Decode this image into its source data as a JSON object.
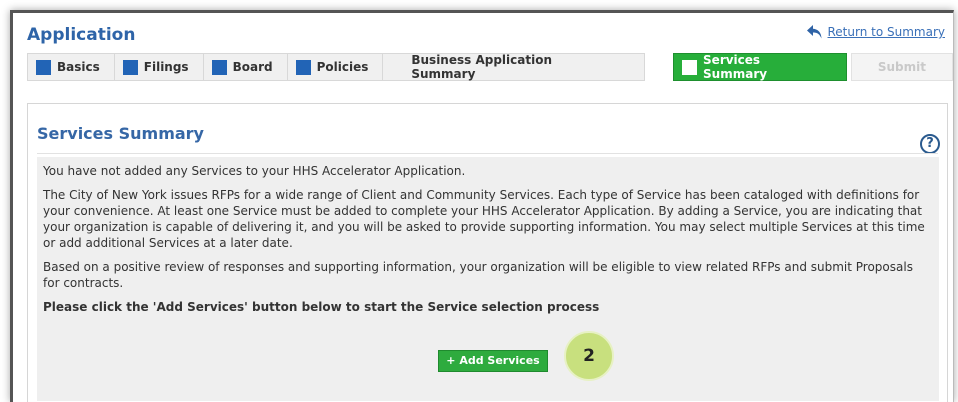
{
  "header": {
    "title": "Application",
    "return_label": "Return to Summary"
  },
  "tabs": [
    {
      "label": "Basics"
    },
    {
      "label": "Filings"
    },
    {
      "label": "Board"
    },
    {
      "label": "Policies"
    },
    {
      "label": "Business Application Summary"
    },
    {
      "label": "Services Summary"
    },
    {
      "label": "Submit"
    }
  ],
  "panel": {
    "title": "Services Summary",
    "help_glyph": "?",
    "paragraphs": [
      "You have not added any Services to your HHS Accelerator Application.",
      "The City of New York issues RFPs for a wide range of Client and Community Services. Each type of Service has been cataloged with definitions for your convenience. At least one Service must be added to complete your HHS Accelerator Application. By adding a Service, you are indicating that your organization is capable of delivering it, and you will be asked to provide supporting information. You may select multiple Services at this time or add additional Services at a later date.",
      "Based on a positive review of responses and supporting information, your organization will be eligible to view related RFPs and submit Proposals for contracts."
    ],
    "instruction": "Please click the 'Add Services' button below to start the Service selection process",
    "add_button_label": "+ Add Services"
  },
  "step_badge": "2",
  "colors": {
    "title_blue": "#2e64a8",
    "tab_square_blue": "#2264b6",
    "active_green": "#27ae3a",
    "badge_green": "#c8e07e"
  },
  "icons": {
    "return": "return-arrow-icon",
    "help": "help-icon"
  }
}
